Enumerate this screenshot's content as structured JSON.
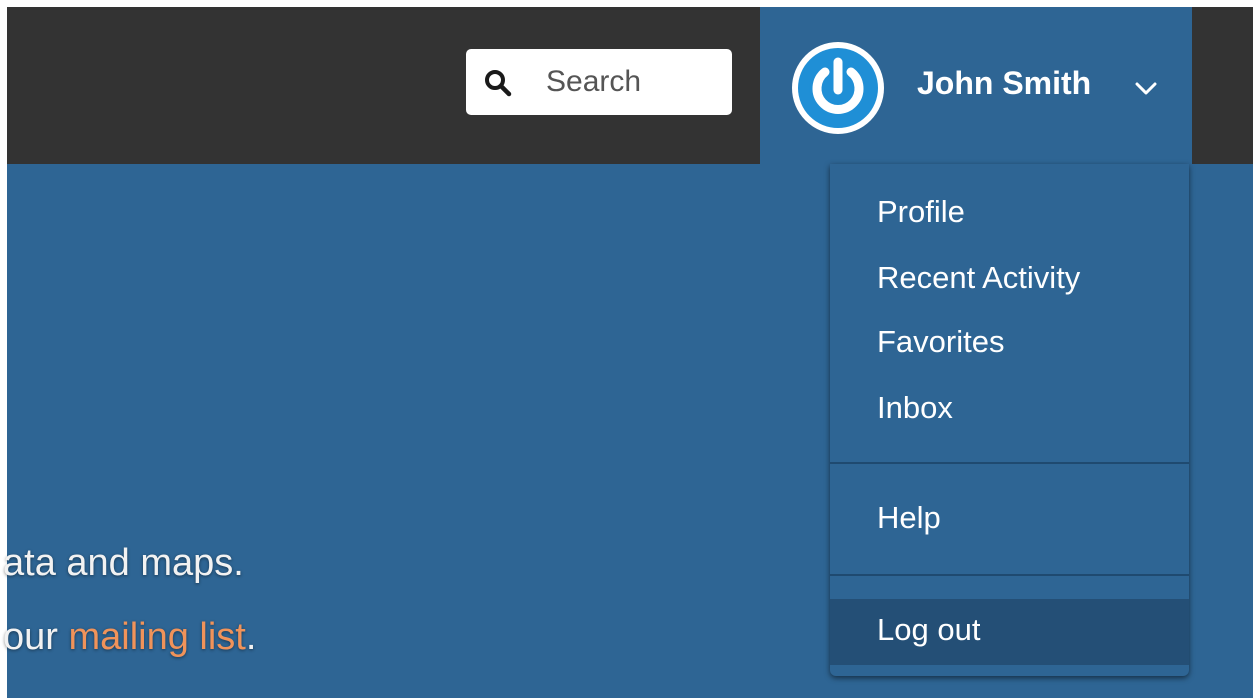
{
  "header": {
    "search": {
      "placeholder": "Search"
    },
    "user": {
      "name": "John Smith"
    }
  },
  "hero": {
    "line1": "ata and maps.",
    "line2_prefix": "our ",
    "line2_link": "mailing list",
    "line2_suffix": "."
  },
  "dropdown": {
    "items": [
      {
        "label": "Profile"
      },
      {
        "label": "Recent Activity"
      },
      {
        "label": "Favorites"
      },
      {
        "label": "Inbox"
      },
      {
        "label": "Help"
      },
      {
        "label": "Log out"
      }
    ]
  },
  "colors": {
    "topbar": "#333333",
    "brand_blue": "#2e6594",
    "link_orange": "#f0935a",
    "logout_highlight": "#244f76"
  },
  "icons": {
    "search": "search-icon",
    "avatar": "power-icon",
    "chevron": "chevron-down-icon"
  }
}
